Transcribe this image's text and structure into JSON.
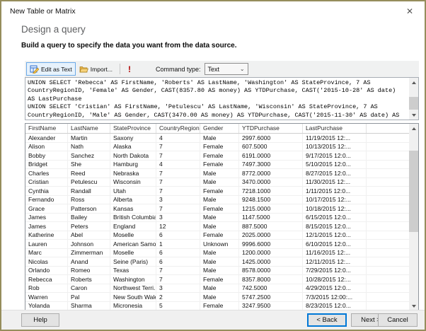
{
  "window": {
    "title": "New Table or Matrix",
    "close_glyph": "✕"
  },
  "header": {
    "title": "Design a query",
    "subtitle": "Build a query to specify the data you want from the data source."
  },
  "toolbar": {
    "edit_as_text_label": "Edit as Text",
    "import_label": "Import...",
    "error_glyph": "!",
    "command_type_label": "Command type:",
    "command_type_value": "Text",
    "chevron_glyph": "⌄"
  },
  "query": {
    "text": "UNION SELECT 'Rebecca' AS FirstName, 'Roberts' AS LastName, 'Washington' AS StateProvince, 7 AS\nCountryRegionID, 'Female' AS Gender, CAST(8357.80 AS money) AS YTDPurchase, CAST('2015-10-28' AS date)\nAS LastPurchase\nUNION SELECT 'Cristian' AS FirstName, 'Petulescu' AS LastName, 'Wisconsin' AS StateProvince, 7 AS\nCountryRegionID, 'Male' AS Gender, CAST(3470.00 AS money) AS YTDPurchase, CAST('2015-11-30' AS date) AS"
  },
  "grid": {
    "columns": [
      "FirstName",
      "LastName",
      "StateProvince",
      "CountryRegionID",
      "Gender",
      "YTDPurchase",
      "LastPurchase"
    ],
    "rows": [
      [
        "Alexander",
        "Martin",
        "Saxony",
        "4",
        "Male",
        "2997.6000",
        "11/19/2015 12:..."
      ],
      [
        "Alison",
        "Nath",
        "Alaska",
        "7",
        "Female",
        "607.5000",
        "10/13/2015 12:..."
      ],
      [
        "Bobby",
        "Sanchez",
        "North Dakota",
        "7",
        "Female",
        "6191.0000",
        "9/17/2015 12:0..."
      ],
      [
        "Bridget",
        "She",
        "Hamburg",
        "4",
        "Female",
        "7497.3000",
        "5/10/2015 12:0..."
      ],
      [
        "Charles",
        "Reed",
        "Nebraska",
        "7",
        "Male",
        "8772.0000",
        "8/27/2015 12:0..."
      ],
      [
        "Cristian",
        "Petulescu",
        "Wisconsin",
        "7",
        "Male",
        "3470.0000",
        "11/30/2015 12:..."
      ],
      [
        "Cynthia",
        "Randall",
        "Utah",
        "7",
        "Female",
        "7218.1000",
        "1/11/2015 12:0..."
      ],
      [
        "Fernando",
        "Ross",
        "Alberta",
        "3",
        "Male",
        "9248.1500",
        "10/17/2015 12:..."
      ],
      [
        "Grace",
        "Patterson",
        "Kansas",
        "7",
        "Female",
        "1215.0000",
        "10/18/2015 12:..."
      ],
      [
        "James",
        "Bailey",
        "British Columbia",
        "3",
        "Male",
        "1147.5000",
        "6/15/2015 12:0..."
      ],
      [
        "James",
        "Peters",
        "England",
        "12",
        "Male",
        "887.5000",
        "8/15/2015 12:0..."
      ],
      [
        "Katherine",
        "Abel",
        "Moselle",
        "6",
        "Female",
        "2025.0000",
        "12/1/2015 12:0..."
      ],
      [
        "Lauren",
        "Johnson",
        "American Samoa",
        "1",
        "Unknown",
        "9996.6000",
        "6/10/2015 12:0..."
      ],
      [
        "Marc",
        "Zimmerman",
        "Moselle",
        "6",
        "Male",
        "1200.0000",
        "11/16/2015 12:..."
      ],
      [
        "Nicolas",
        "Anand",
        "Seine (Paris)",
        "6",
        "Male",
        "1425.0000",
        "12/11/2015 12:..."
      ],
      [
        "Orlando",
        "Romeo",
        "Texas",
        "7",
        "Male",
        "8578.0000",
        "7/29/2015 12:0..."
      ],
      [
        "Rebecca",
        "Roberts",
        "Washington",
        "7",
        "Female",
        "8357.8000",
        "10/28/2015 12:..."
      ],
      [
        "Rob",
        "Caron",
        "Northwest Terri...",
        "3",
        "Male",
        "742.5000",
        "4/29/2015 12:0..."
      ],
      [
        "Warren",
        "Pal",
        "New South Wales",
        "2",
        "Male",
        "5747.2500",
        "7/3/2015 12:00:..."
      ],
      [
        "Yolanda",
        "Sharma",
        "Micronesia",
        "5",
        "Female",
        "3247.9500",
        "8/23/2015 12:0..."
      ]
    ]
  },
  "footer": {
    "help_label": "Help",
    "back_label": "< Back",
    "next_label": "Next >",
    "cancel_label": "Cancel"
  },
  "colors": {
    "focus_accent": "#0078d7",
    "dialog_border": "#968d5c",
    "error_red": "#b00000",
    "toolbar_bg": "#f0f1f1",
    "folder_yellow": "#f2c04a",
    "edit_icon_blue": "#2e6fd0"
  }
}
